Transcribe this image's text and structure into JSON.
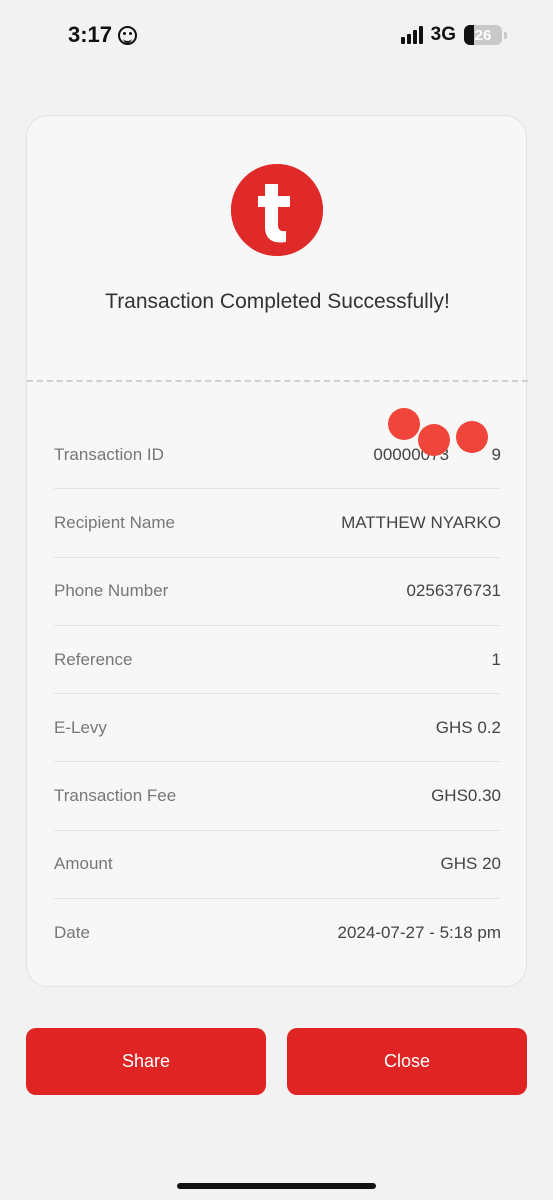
{
  "status_bar": {
    "time": "3:17",
    "emoji_icon": "smiling-face-icon",
    "network": "3G",
    "battery": "26"
  },
  "receipt": {
    "logo_icon": "telecel-t-logo",
    "title": "Transaction Completed Successfully!",
    "rows": [
      {
        "label": "Transaction ID",
        "value": "00000073         9"
      },
      {
        "label": "Recipient Name",
        "value": "MATTHEW NYARKO"
      },
      {
        "label": "Phone Number",
        "value": "0256376731"
      },
      {
        "label": "Reference",
        "value": "1"
      },
      {
        "label": "E-Levy",
        "value": "GHS 0.2"
      },
      {
        "label": "Transaction Fee",
        "value": "GHS0.30"
      },
      {
        "label": "Amount",
        "value": "GHS 20"
      },
      {
        "label": "Date",
        "value": "2024-07-27 - 5:18 pm"
      }
    ]
  },
  "buttons": {
    "share_label": "Share",
    "close_label": "Close"
  },
  "colors": {
    "brand_red": "#e02424",
    "background": "#f2f2f2"
  }
}
